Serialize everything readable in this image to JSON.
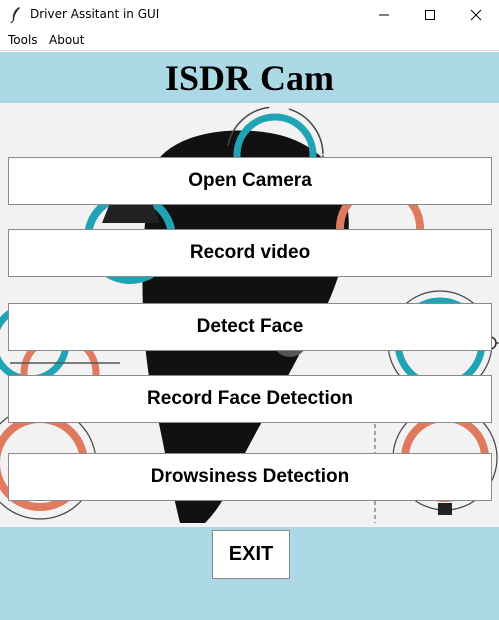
{
  "window": {
    "title": "Driver Assitant in GUI",
    "icon": "feather-icon",
    "controls": [
      "minimize-icon",
      "maximize-icon",
      "close-icon"
    ]
  },
  "menu": {
    "items": [
      {
        "label": "Tools"
      },
      {
        "label": "About"
      }
    ]
  },
  "header": {
    "title": "ISDR Cam"
  },
  "buttons": {
    "open_camera": "Open Camera",
    "record_video": "Record video",
    "detect_face": "Detect Face",
    "record_face_detection": "Record Face Detection",
    "drowsiness_detection": "Drowsiness Detection",
    "exit": "EXIT"
  },
  "colors": {
    "header_bg": "#add8e6",
    "footer_bg": "#add8e6",
    "accent_teal": "#1fa3b5",
    "accent_orange": "#e07a5f"
  }
}
